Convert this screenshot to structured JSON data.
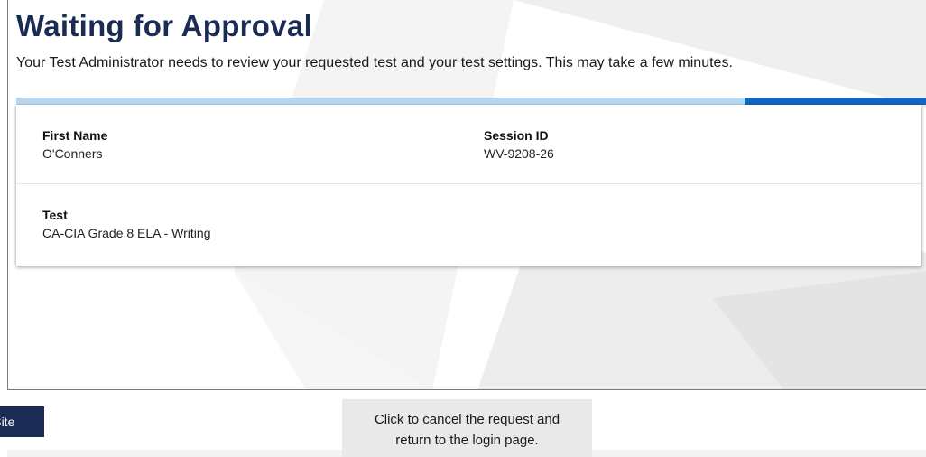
{
  "page": {
    "title": "Waiting for Approval",
    "subtitle": "Your Test Administrator needs to review your requested test and your test settings. This may take a few minutes."
  },
  "progress": {
    "fraction_remaining_highlight": 0.2,
    "track_color": "#b7d6f0",
    "fill_color": "#1666c0"
  },
  "card": {
    "first_name": {
      "label": "First Name",
      "value": "O'Conners"
    },
    "session_id": {
      "label": "Session ID",
      "value": "WV-9208-26"
    },
    "test": {
      "label": "Test",
      "value": "CA-CIA Grade 8 ELA - Writing"
    }
  },
  "footer": {
    "exit_label": "Exit Site",
    "cancel_label": "Click to cancel the request and return to the login page."
  },
  "colors": {
    "brand_navy": "#1b2c54",
    "cancel_bg": "#e9e9e9"
  }
}
